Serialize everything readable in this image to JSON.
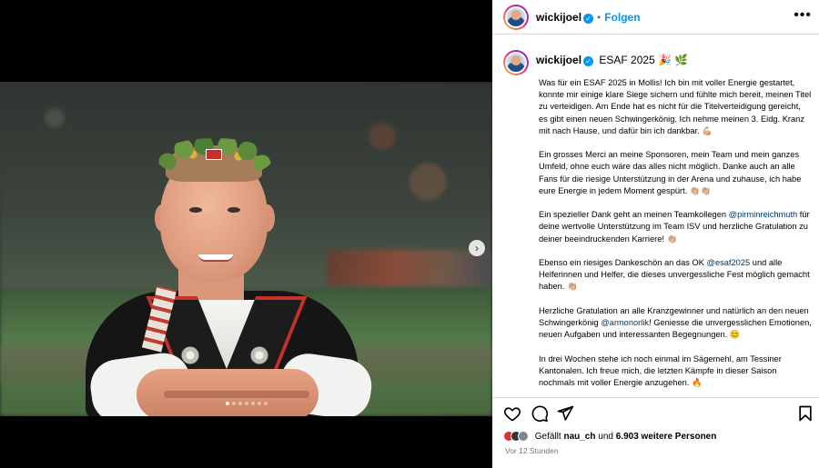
{
  "header": {
    "username": "wickijoel",
    "separator": "•",
    "follow_label": "Folgen",
    "more_label": "•••"
  },
  "caption": {
    "username": "wickijoel",
    "title": "ESAF 2025 🎉 🌿",
    "paragraphs": [
      [
        {
          "t": "Was für ein ESAF 2025 in Mollis! Ich bin mit voller Energie gestartet, konnte mir einige klare Siege sichern und fühlte mich bereit, meinen Titel zu verteidigen. Am Ende hat es nicht für die Titelverteidigung gereicht, es gibt einen neuen Schwingerkönig. Ich nehme meinen 3. Eidg. Kranz mit nach Hause, und dafür bin ich dankbar. 💪🏼"
        }
      ],
      [
        {
          "t": "Ein grosses Merci an meine Sponsoren, mein Team und mein ganzes Umfeld, ohne euch wäre das alles nicht möglich. Danke auch an alle Fans für die riesige Unterstützung in der Arena und zuhause, ich habe eure Energie in jedem Moment gespürt. 👏🏼👏🏼"
        }
      ],
      [
        {
          "t": "Ein spezieller Dank geht an meinen Teamkollegen "
        },
        {
          "t": "@pirminreichmuth",
          "m": true
        },
        {
          "t": " für deine wertvolle Unterstützung im Team ISV und herzliche Gratulation zu deiner beeindruckenden Karriere! 👏🏼"
        }
      ],
      [
        {
          "t": "Ebenso ein riesiges Dankeschön an das OK "
        },
        {
          "t": "@esaf2025",
          "m": true
        },
        {
          "t": " und alle Helferinnen und Helfer, die dieses unvergessliche Fest möglich gemacht haben. 👏🏼"
        }
      ],
      [
        {
          "t": "Herzliche Gratulation an alle Kranzgewinner und natürlich an den neuen Schwingerkönig "
        },
        {
          "t": "@armonorlik",
          "m": true
        },
        {
          "t": "! Geniesse die unvergesslichen Emotionen, neuen Aufgaben und interessanten Begegnungen. 😊"
        }
      ],
      [
        {
          "t": "In drei Wochen stehe ich noch einmal im Sägemehl, am Tessiner Kantonalen. Ich freue mich, die letzten Kämpfe in dieser Saison nochmals mit voller Energie anzugehen. 🔥"
        }
      ]
    ]
  },
  "likes": {
    "label_prefix": "Gefällt",
    "liker": "nau_ch",
    "connector": "und",
    "others": "6.903 weitere Personen"
  },
  "timestamp": "Vor 12 Stunden",
  "carousel": {
    "count": 7,
    "active_index": 0
  },
  "icons": {
    "like": "heart-icon",
    "comment": "comment-icon",
    "share": "send-icon",
    "save": "bookmark-icon",
    "next": "chevron-right-icon",
    "verified": "verified-badge-icon"
  },
  "colors": {
    "link": "#0095f6",
    "mention": "#00376b",
    "meta": "#737373",
    "verified": "#0095f6"
  }
}
